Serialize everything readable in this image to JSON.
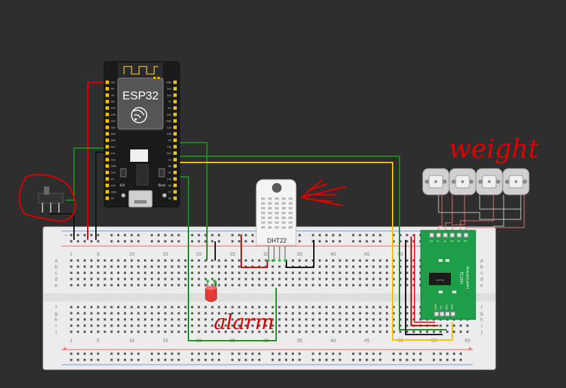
{
  "esp32": {
    "title": "ESP32",
    "boot_label": "Boot",
    "en_label": "EN",
    "left_pins": [
      "3V3",
      "EN",
      "VP",
      "VN",
      "D34",
      "D35",
      "D32",
      "D33",
      "D25",
      "D26",
      "D27",
      "D14",
      "D12",
      "GND",
      "D13",
      "D2",
      "D15",
      "CMD",
      "5V"
    ],
    "right_pins": [
      "GND",
      "D23",
      "D22",
      "TX",
      "RX",
      "D21",
      "GND",
      "D19",
      "D18",
      "D5",
      "TX2",
      "RX2",
      "D4",
      "D0",
      "D2",
      "D15",
      "D8",
      "D7",
      "D6"
    ]
  },
  "dht22": {
    "label": "DHT22"
  },
  "led": {
    "color": "#e53935"
  },
  "hx711": {
    "title": "HX711",
    "subtitle": "Load Cell Amp",
    "chip_text": "HX711",
    "top_pins": [
      "E+",
      "E-",
      "A-",
      "A+",
      "B-",
      "B+"
    ],
    "bottom_pins": [
      "GND",
      "DT",
      "SCK",
      "VCC"
    ]
  },
  "breadboard": {
    "column_numbers": [
      "1",
      "5",
      "10",
      "15",
      "20",
      "25",
      "30",
      "35",
      "40",
      "45",
      "50",
      "55",
      "60"
    ],
    "row_letters_top": [
      "a",
      "b",
      "c",
      "d",
      "e"
    ],
    "row_letters_bottom": [
      "f",
      "g",
      "h",
      "i",
      "j"
    ]
  },
  "annotations": {
    "weight": "weight",
    "alarm": "alarm"
  },
  "colors": {
    "background": "#2e2e2e",
    "board": "#1a1a1a",
    "breadboard": "#ececec",
    "rail_red": "#e53935",
    "rail_blue": "#3b7ddd",
    "hx711_green": "#1f9e4a",
    "wire_green": "#1b8a1b",
    "wire_yellow": "#f2c200",
    "wire_red": "#e00000",
    "wire_black": "#111111",
    "annotation": "#e00000"
  }
}
